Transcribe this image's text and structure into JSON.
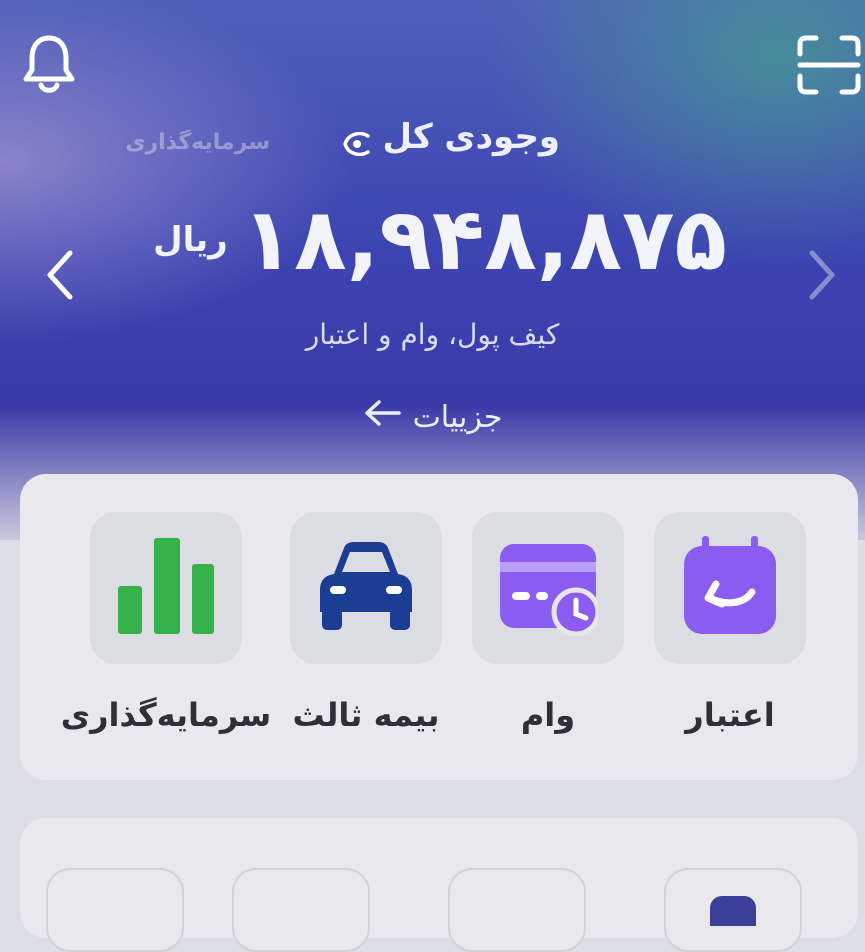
{
  "header": {
    "bell_icon": "bell-icon",
    "scan_icon": "scan-icon"
  },
  "balance": {
    "title": "وجودی کل",
    "ghost_tab_label": "سرمایه‌گذاری",
    "amount": "۱۸,۹۴۸,۸۷۵",
    "unit": "ریال",
    "subtitle": "کیف پول، وام و اعتبار",
    "details_label": "جزییات"
  },
  "services": [
    {
      "label": "اعتبار",
      "icon": "credit-calendar-icon",
      "color": "#8a5cf0"
    },
    {
      "label": "وام",
      "icon": "loan-card-icon",
      "color": "#8a5cf0"
    },
    {
      "label": "بیمه ثالث",
      "icon": "car-icon",
      "color": "#1b3d93"
    },
    {
      "label": "سرمایه‌گذاری",
      "icon": "bar-chart-icon",
      "color": "#35b24a"
    }
  ],
  "colors": {
    "hero_blue": "#3d45b2",
    "accent_purple": "#8a5cf0",
    "green": "#35b24a",
    "car_blue": "#1b3d93"
  }
}
